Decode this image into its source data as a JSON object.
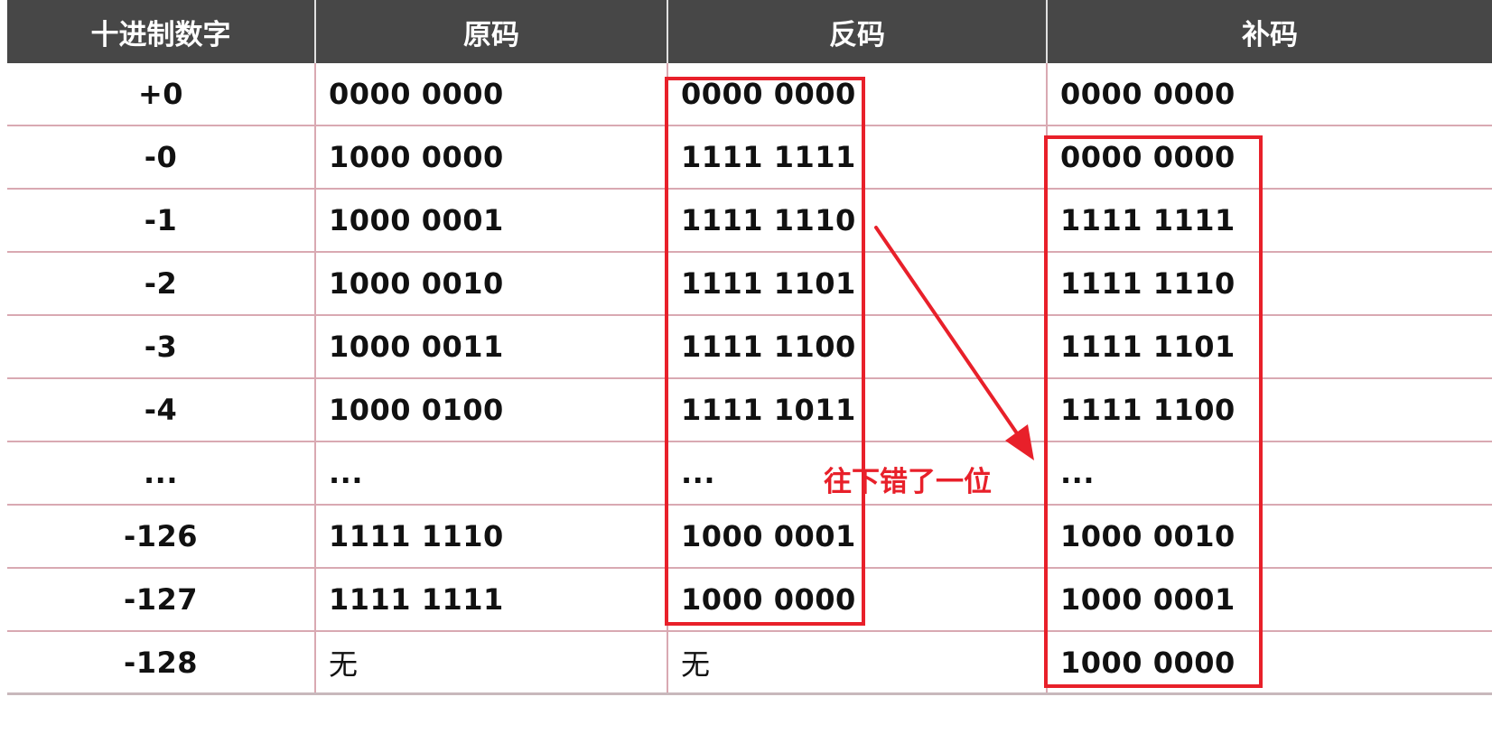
{
  "headers": [
    "十进制数字",
    "原码",
    "反码",
    "补码"
  ],
  "rows": [
    {
      "decimal": "+0",
      "original": "0000 0000",
      "ones": "0000 0000",
      "twos": "0000 0000"
    },
    {
      "decimal": "-0",
      "original": "1000 0000",
      "ones": "1111 1111",
      "twos": "0000 0000"
    },
    {
      "decimal": "-1",
      "original": "1000 0001",
      "ones": "1111 1110",
      "twos": "1111 1111"
    },
    {
      "decimal": "-2",
      "original": "1000 0010",
      "ones": "1111 1101",
      "twos": "1111 1110"
    },
    {
      "decimal": "-3",
      "original": "1000 0011",
      "ones": "1111 1100",
      "twos": "1111 1101"
    },
    {
      "decimal": "-4",
      "original": "1000 0100",
      "ones": "1111 1011",
      "twos": "1111 1100"
    },
    {
      "decimal": "...",
      "original": "...",
      "ones": "...",
      "twos": "..."
    },
    {
      "decimal": "-126",
      "original": "1111 1110",
      "ones": "1000 0001",
      "twos": "1000 0010"
    },
    {
      "decimal": "-127",
      "original": "1111 1111",
      "ones": "1000 0000",
      "twos": "1000 0001"
    },
    {
      "decimal": "-128",
      "original": "无",
      "ones": "无",
      "twos": "1000 0000"
    }
  ],
  "annotation": {
    "text": "往下错了一位",
    "color": "#e8202a"
  },
  "colors": {
    "header_bg": "#474747",
    "header_text": "#ffffff",
    "grid_line": "#d9a9b2",
    "highlight": "#e8202a"
  }
}
